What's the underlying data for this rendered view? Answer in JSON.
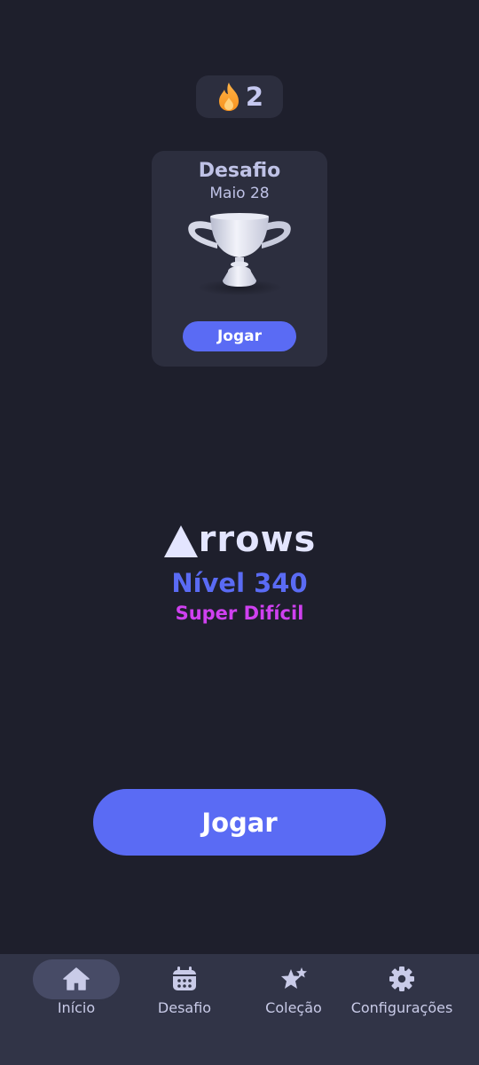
{
  "streak": {
    "count": "2",
    "icon": "flame-icon"
  },
  "challenge_card": {
    "title": "Desafio",
    "date": "Maio 28",
    "icon": "trophy-icon",
    "play_label": "Jogar"
  },
  "game": {
    "logo_text": "rrows",
    "level": "Nível 340",
    "difficulty": "Super Difícil"
  },
  "main": {
    "play_label": "Jogar"
  },
  "bottom_nav": {
    "items": [
      {
        "label": "Início",
        "icon": "home-icon",
        "active": true
      },
      {
        "label": "Desafio",
        "icon": "calendar-icon",
        "active": false
      },
      {
        "label": "Coleção",
        "icon": "stars-icon",
        "active": false
      },
      {
        "label": "Configurações",
        "icon": "gear-icon",
        "active": false
      }
    ]
  },
  "colors": {
    "background": "#1e1f2c",
    "card": "#2c2e3e",
    "accent": "#5a6bf4",
    "difficulty": "#cf40f0",
    "nav_bg": "#313447",
    "nav_active": "#474b66"
  }
}
